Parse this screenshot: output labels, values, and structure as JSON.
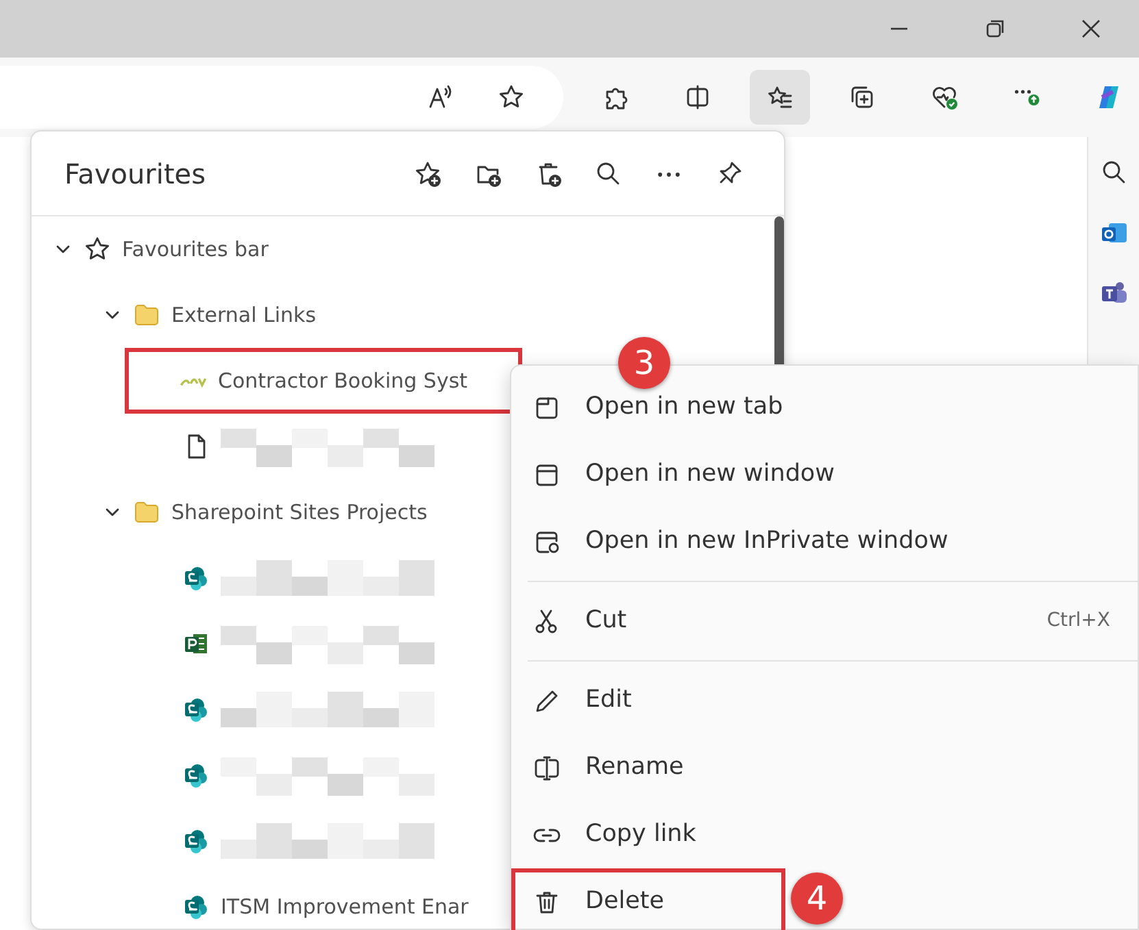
{
  "toolbar": {
    "buttons": [
      {
        "kind": "read-aloud",
        "selected": false
      },
      {
        "kind": "favorite",
        "selected": false
      },
      {
        "kind": "extensions",
        "selected": false
      },
      {
        "kind": "split",
        "selected": false
      },
      {
        "kind": "favourites",
        "selected": true
      },
      {
        "kind": "collections",
        "selected": false
      },
      {
        "kind": "health",
        "selected": false
      },
      {
        "kind": "more",
        "selected": false
      },
      {
        "kind": "copilot",
        "selected": false
      }
    ]
  },
  "favourites": {
    "title": "Favourites",
    "tree": [
      {
        "kind": "bar",
        "label": "Favourites bar",
        "expanded": true,
        "children": [
          {
            "kind": "folder",
            "label": "External Links",
            "expanded": true,
            "children": [
              {
                "kind": "site",
                "label": "Contractor Booking Syst",
                "callout": "3"
              },
              {
                "kind": "page",
                "redacted": true
              }
            ]
          },
          {
            "kind": "folder",
            "label": "Sharepoint Sites Projects",
            "expanded": true,
            "children": [
              {
                "kind": "sharepoint",
                "redacted": true
              },
              {
                "kind": "project",
                "redacted": true
              },
              {
                "kind": "sharepoint",
                "redacted": true
              },
              {
                "kind": "sharepoint",
                "redacted": true
              },
              {
                "kind": "sharepoint",
                "redacted": true
              },
              {
                "kind": "sharepoint",
                "label": "ITSM Improvement Enar"
              }
            ]
          }
        ]
      }
    ]
  },
  "context_menu": {
    "groups": [
      [
        {
          "kind": "tab",
          "label": "Open in new tab"
        },
        {
          "kind": "window",
          "label": "Open in new window"
        },
        {
          "kind": "private",
          "label": "Open in new InPrivate window"
        }
      ],
      [
        {
          "kind": "cut",
          "label": "Cut",
          "shortcut": "Ctrl+X"
        }
      ],
      [
        {
          "kind": "edit",
          "label": "Edit"
        },
        {
          "kind": "rename",
          "label": "Rename"
        },
        {
          "kind": "link",
          "label": "Copy link"
        },
        {
          "kind": "delete",
          "label": "Delete",
          "callout": "4"
        }
      ]
    ]
  }
}
